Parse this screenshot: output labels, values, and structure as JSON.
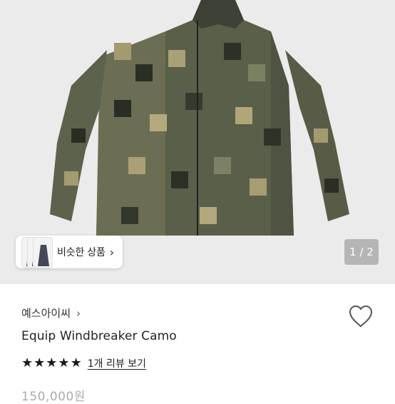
{
  "gallery": {
    "similar_label": "비슷한 상품",
    "similar_chevron": "›",
    "page_indicator": "1 / 2",
    "image_alt": "camo-windbreaker-jacket-photo"
  },
  "product": {
    "shop_name": "예스아이씨",
    "shop_chevron": "›",
    "name": "Equip Windbreaker Camo",
    "rating": 5,
    "rating_max": 5,
    "star_glyph": "★",
    "review_link": "1개 리뷰 보기",
    "price": "150,000원"
  },
  "colors": {
    "gallery_bg": "#ebebeb",
    "star": "#1a1a1a",
    "price": "#aaaaaa"
  },
  "icons": {
    "heart": "heart-outline-icon",
    "shop_chevron": "chevron-right-icon"
  }
}
